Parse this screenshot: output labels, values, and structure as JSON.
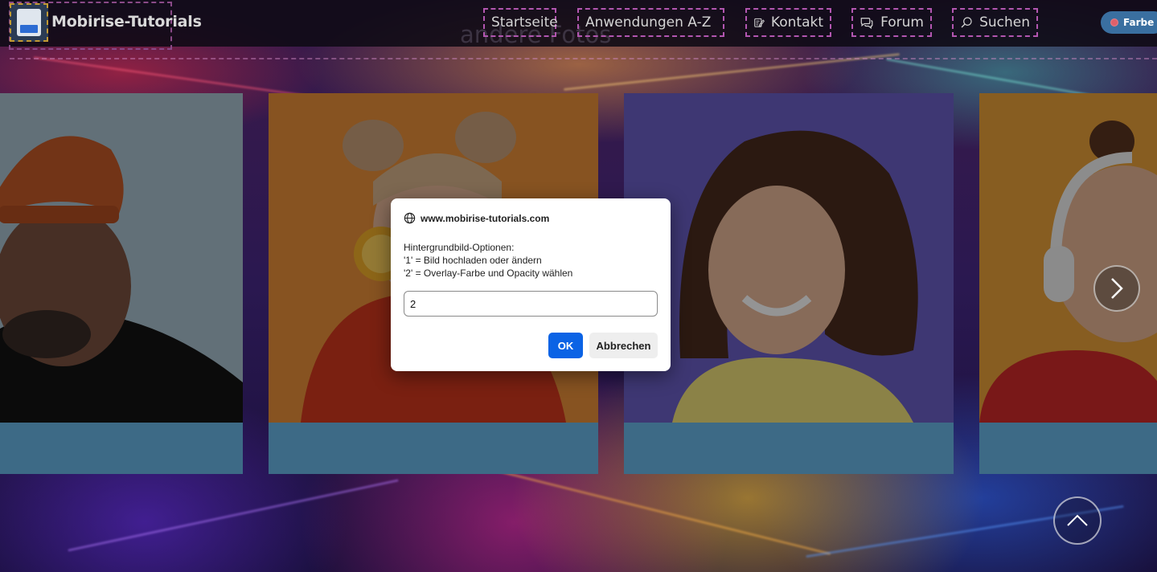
{
  "navbar": {
    "brand_name": "Mobirise-Tutorials",
    "ghost_title": "andere Fotos",
    "items": [
      {
        "label": "Startseite"
      },
      {
        "label": "Anwendungen A-Z"
      },
      {
        "label": "Kontakt"
      },
      {
        "label": "Forum"
      },
      {
        "label": "Suchen"
      }
    ],
    "color_button": "Farbe"
  },
  "dialog": {
    "origin": "www.mobirise-tutorials.com",
    "message_lines": [
      "Hintergrundbild-Optionen:",
      "'1' = Bild hochladen oder ändern",
      "'2' = Overlay-Farbe und Opacity wählen"
    ],
    "input_value": "2",
    "ok_label": "OK",
    "cancel_label": "Abbrechen"
  },
  "colors": {
    "card_footer": "#3d6a86",
    "ok_button": "#0b63e5",
    "nav_dashed_border": "#b256b0",
    "color_button_bg": "#3a6fa0"
  },
  "icons": [
    "globe-icon",
    "edit-icon",
    "chat-bubbles-icon",
    "search-icon",
    "caret-down-icon",
    "chevron-right-icon",
    "chevron-up-icon"
  ]
}
